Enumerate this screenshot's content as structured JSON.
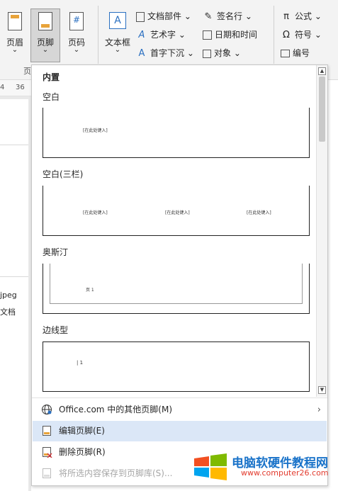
{
  "ribbon": {
    "header_btn": "页眉",
    "footer_btn": "页脚",
    "pagenum_btn": "页码",
    "textbox_btn": "文本框",
    "col1": [
      "文档部件",
      "艺术字",
      "首字下沉"
    ],
    "col2": [
      "签名行",
      "日期和时间",
      "对象"
    ],
    "col3": [
      "公式",
      "符号",
      "编号"
    ],
    "group_label_partial": "页",
    "pagenum_glyph": "#",
    "textbox_glyph": "A"
  },
  "ruler": {
    "ticks": [
      "4",
      "36"
    ]
  },
  "doc": {
    "snippets": [
      "jpeg",
      "文档"
    ]
  },
  "gallery": {
    "section_builtin": "内置",
    "items": [
      {
        "title": "空白",
        "placeholders": [
          "[在此处键入]"
        ]
      },
      {
        "title": "空白(三栏)",
        "placeholders": [
          "[在此处键入]",
          "[在此处键入]",
          "[在此处键入]"
        ]
      },
      {
        "title": "奥斯汀",
        "placeholders": [
          "页 1"
        ]
      },
      {
        "title": "边线型",
        "placeholders": [
          "| 1"
        ]
      }
    ]
  },
  "menu": {
    "more_online": "Office.com 中的其他页脚(M)",
    "edit_footer": "编辑页脚(E)",
    "remove_footer": "删除页脚(R)",
    "save_selection": "将所选内容保存到页脚库(S)..."
  },
  "watermark": {
    "title": "电脑软硬件教程网",
    "url": "www.computer26.com"
  },
  "colors": {
    "hover": "#dbe7f7",
    "active_btn": "#d6d6d6",
    "watermark_blue": "#1a73c9",
    "watermark_red": "#e23b2e"
  }
}
